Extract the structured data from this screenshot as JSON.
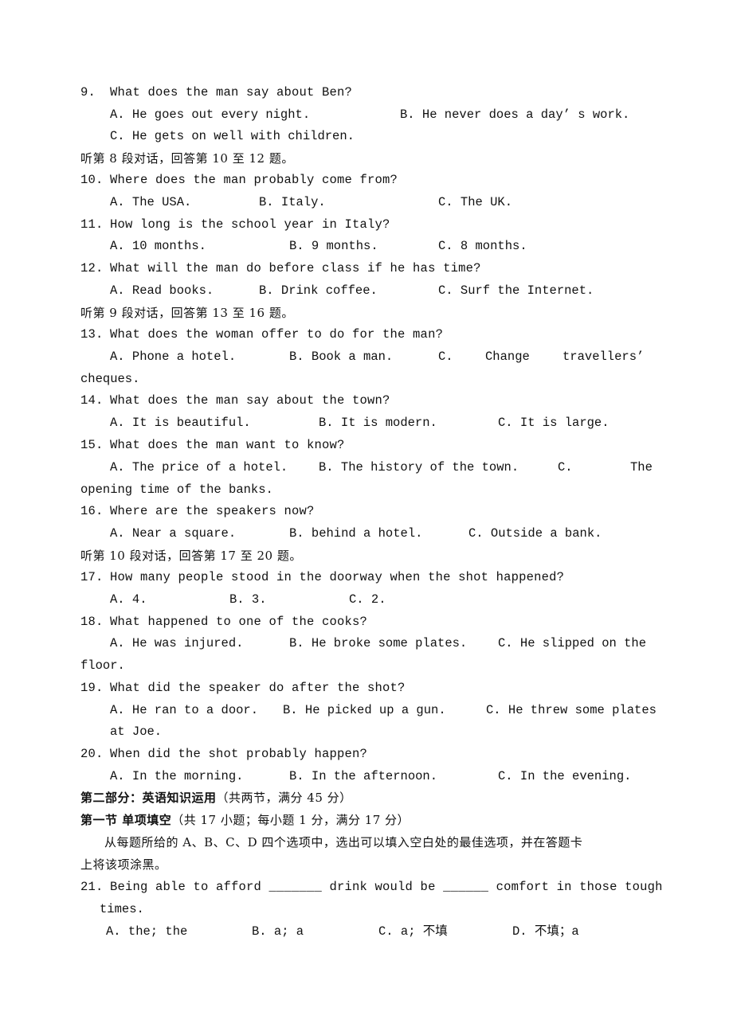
{
  "questions_part1": [
    {
      "num": "9.",
      "text": "What does the man say about Ben?",
      "options": [
        "A. He goes out every night.",
        "B. He never does a day’ s work.",
        "C. He gets on well with children."
      ]
    },
    {
      "section": "听第 8 段对话，回答第 10 至 12 题。"
    },
    {
      "num": "10.",
      "text": "Where does the man probably come from?",
      "options": [
        "A. The USA.",
        "B. Italy.",
        "C. The UK."
      ]
    },
    {
      "num": "11.",
      "text": "How long is the school year in Italy?",
      "options": [
        "A. 10 months.",
        "B. 9 months.",
        "C. 8 months."
      ]
    },
    {
      "num": "12.",
      "text": "What will the man do before class if he has time?",
      "options": [
        "A. Read books.",
        "B. Drink coffee.",
        "C. Surf the Internet."
      ]
    },
    {
      "section": "听第 9 段对话，回答第 13 至 16 题。"
    },
    {
      "num": "13.",
      "text": "What does the woman offer to do for the man?",
      "options": [
        "A. Phone a hotel.",
        "B. Book a man.",
        "C.",
        "Change",
        "travellers’",
        "cheques."
      ]
    },
    {
      "num": "14.",
      "text": "What does the man say about the town?",
      "options": [
        "A. It is beautiful.",
        "B. It is modern.",
        "C. It is large."
      ]
    },
    {
      "num": "15.",
      "text": "What does the man want to know?",
      "options": [
        "A. The price of a hotel.",
        "B. The history of the town.",
        "C.",
        "The",
        "opening time of the banks."
      ]
    },
    {
      "num": "16.",
      "text": "Where are the speakers now?",
      "options": [
        "A. Near a square.",
        "B. behind a hotel.",
        "C. Outside a bank."
      ]
    },
    {
      "section": "听第 10 段对话，回答第 17 至 20 题。"
    },
    {
      "num": "17.",
      "text": "How many people stood in the doorway when the shot happened?",
      "options": [
        "A. 4.",
        "B. 3.",
        "C. 2."
      ]
    },
    {
      "num": "18.",
      "text": "What happened to one of the cooks?",
      "options": [
        "A. He was injured.",
        "B. He broke some plates.",
        "C. He slipped on the",
        "floor."
      ]
    },
    {
      "num": "19.",
      "text": "What did the speaker do after the shot?",
      "options": [
        "A. He ran to a door.",
        "B. He picked up a gun.",
        "C. He threw some plates",
        "at Joe."
      ]
    },
    {
      "num": "20.",
      "text": "When did the shot probably happen?",
      "options": [
        "A. In the morning.",
        "B. In the afternoon.",
        "C. In the evening."
      ]
    }
  ],
  "part2": {
    "heading_bold": "第二部分：英语知识运用",
    "heading_rest": "（共两节，满分 45 分）",
    "section1_bold": "第一节 单项填空",
    "section1_rest": "（共 17 小题；每小题 1 分，满分 17 分）",
    "instruction_line1": "从每题所给的 A、B、C、D 四个选项中，选出可以填入空白处的最佳选项，并在答题卡",
    "instruction_line2": "上将该项涂黑。"
  },
  "question21": {
    "num": "21.",
    "text": "Being able to afford _______ drink would be ______ comfort in those tough",
    "text_cont": "times.",
    "options": [
      "A. the; the",
      "B. a; a",
      "C. a; 不填",
      "D. 不填；a"
    ]
  }
}
